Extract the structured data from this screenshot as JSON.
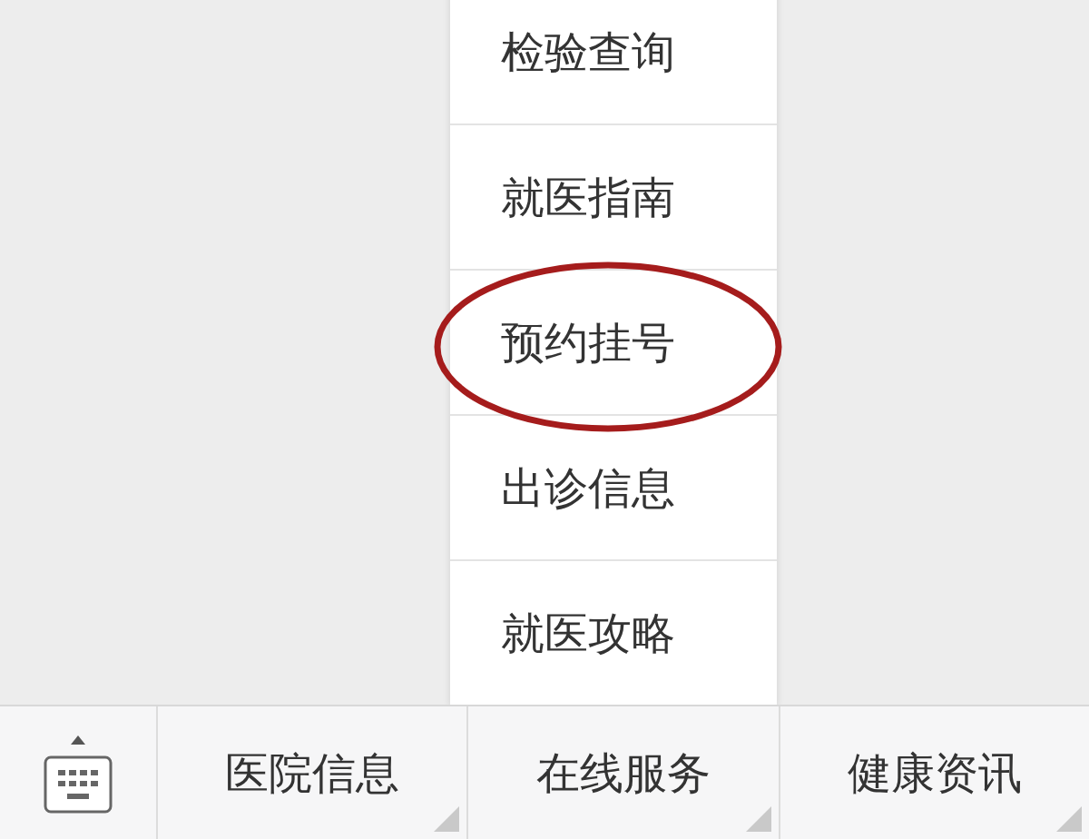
{
  "submenu": [
    {
      "label": "检验查询",
      "circled": false
    },
    {
      "label": "就医指南",
      "circled": false
    },
    {
      "label": "预约挂号",
      "circled": true
    },
    {
      "label": "出诊信息",
      "circled": false
    },
    {
      "label": "就医攻略",
      "circled": false
    }
  ],
  "menu_bar": [
    {
      "label": "医院信息",
      "has_submenu": true
    },
    {
      "label": "在线服务",
      "has_submenu": true
    },
    {
      "label": "健康资讯",
      "has_submenu": true
    }
  ]
}
